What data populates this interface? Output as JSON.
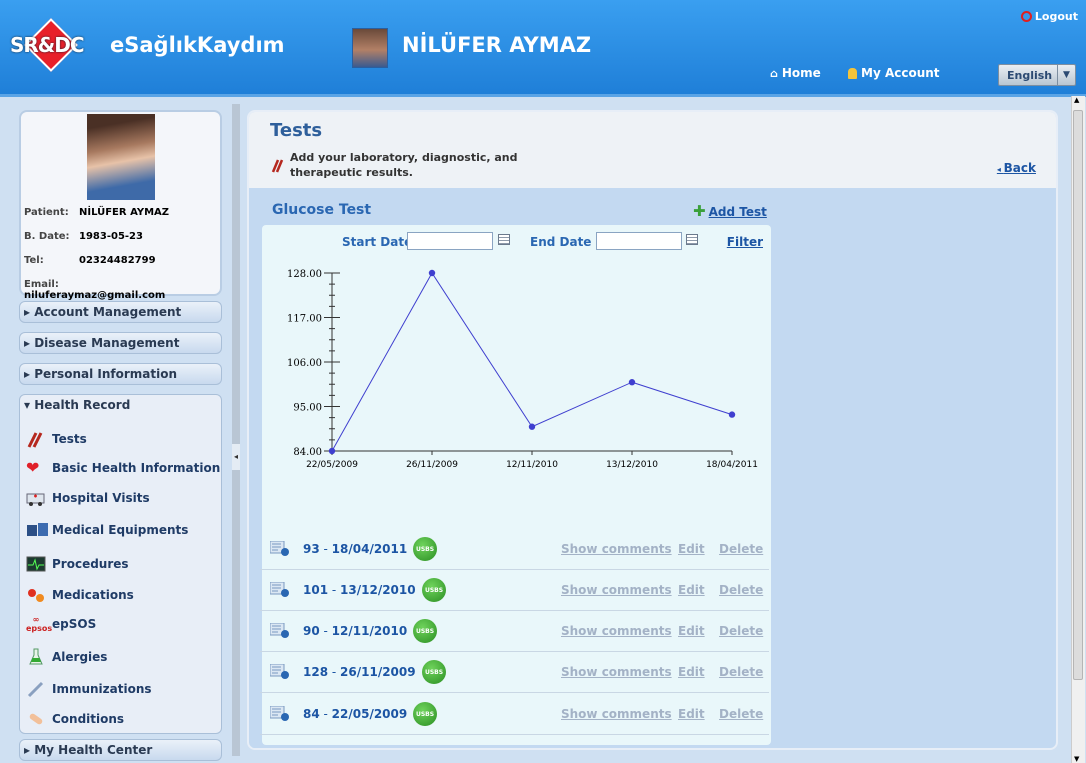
{
  "header": {
    "logo_text": "SR&DC",
    "site_title": "eSağlıkKaydım",
    "user_name": "NİLÜFER AYMAZ",
    "logout": "Logout",
    "nav": {
      "home": "Home",
      "my_account": "My Account"
    },
    "language": "English"
  },
  "profile": {
    "patient_label": "Patient:",
    "patient": "NİLÜFER AYMAZ",
    "bdate_label": "B. Date:",
    "bdate": "1983-05-23",
    "tel_label": "Tel:",
    "tel": "02324482799",
    "email_label": "Email:",
    "email": "niluferaymaz@gmail.com"
  },
  "sidebar": {
    "sections": [
      "Account Management",
      "Disease Management",
      "Personal Information",
      "Health Record",
      "My Health Center"
    ],
    "health_items": [
      "Tests",
      "Basic Health Information",
      "Hospital Visits",
      "Medical Equipments",
      "Procedures",
      "Medications",
      "epSOS",
      "Alergies",
      "Immunizations",
      "Conditions"
    ]
  },
  "page": {
    "title": "Tests",
    "description_line1": "Add your laboratory, diagnostic, and",
    "description_line2": "therapeutic results.",
    "back": "Back"
  },
  "glucose": {
    "title": "Glucose  Test",
    "add_test": "Add Test",
    "start_date_label": "Start Date",
    "end_date_label": "End Date",
    "start_date": "",
    "end_date": "",
    "filter": "Filter"
  },
  "chart_data": {
    "type": "line",
    "x": [
      "22/05/2009",
      "26/11/2009",
      "12/11/2010",
      "13/12/2010",
      "18/04/2011"
    ],
    "values": [
      84,
      128,
      90,
      101,
      93
    ],
    "yticks": [
      "84.00",
      "95.00",
      "106.00",
      "117.00",
      "128.00"
    ],
    "ylim": [
      84,
      128
    ],
    "color": "#3f3fcf"
  },
  "results": [
    {
      "value": "93",
      "date": "18/04/2011"
    },
    {
      "value": "101",
      "date": "13/12/2010"
    },
    {
      "value": "90",
      "date": "12/11/2010"
    },
    {
      "value": "128",
      "date": "26/11/2009"
    },
    {
      "value": "84",
      "date": "22/05/2009"
    }
  ],
  "row_actions": {
    "badge": "USBS",
    "comments": "Show comments",
    "edit": "Edit",
    "delete": "Delete"
  }
}
